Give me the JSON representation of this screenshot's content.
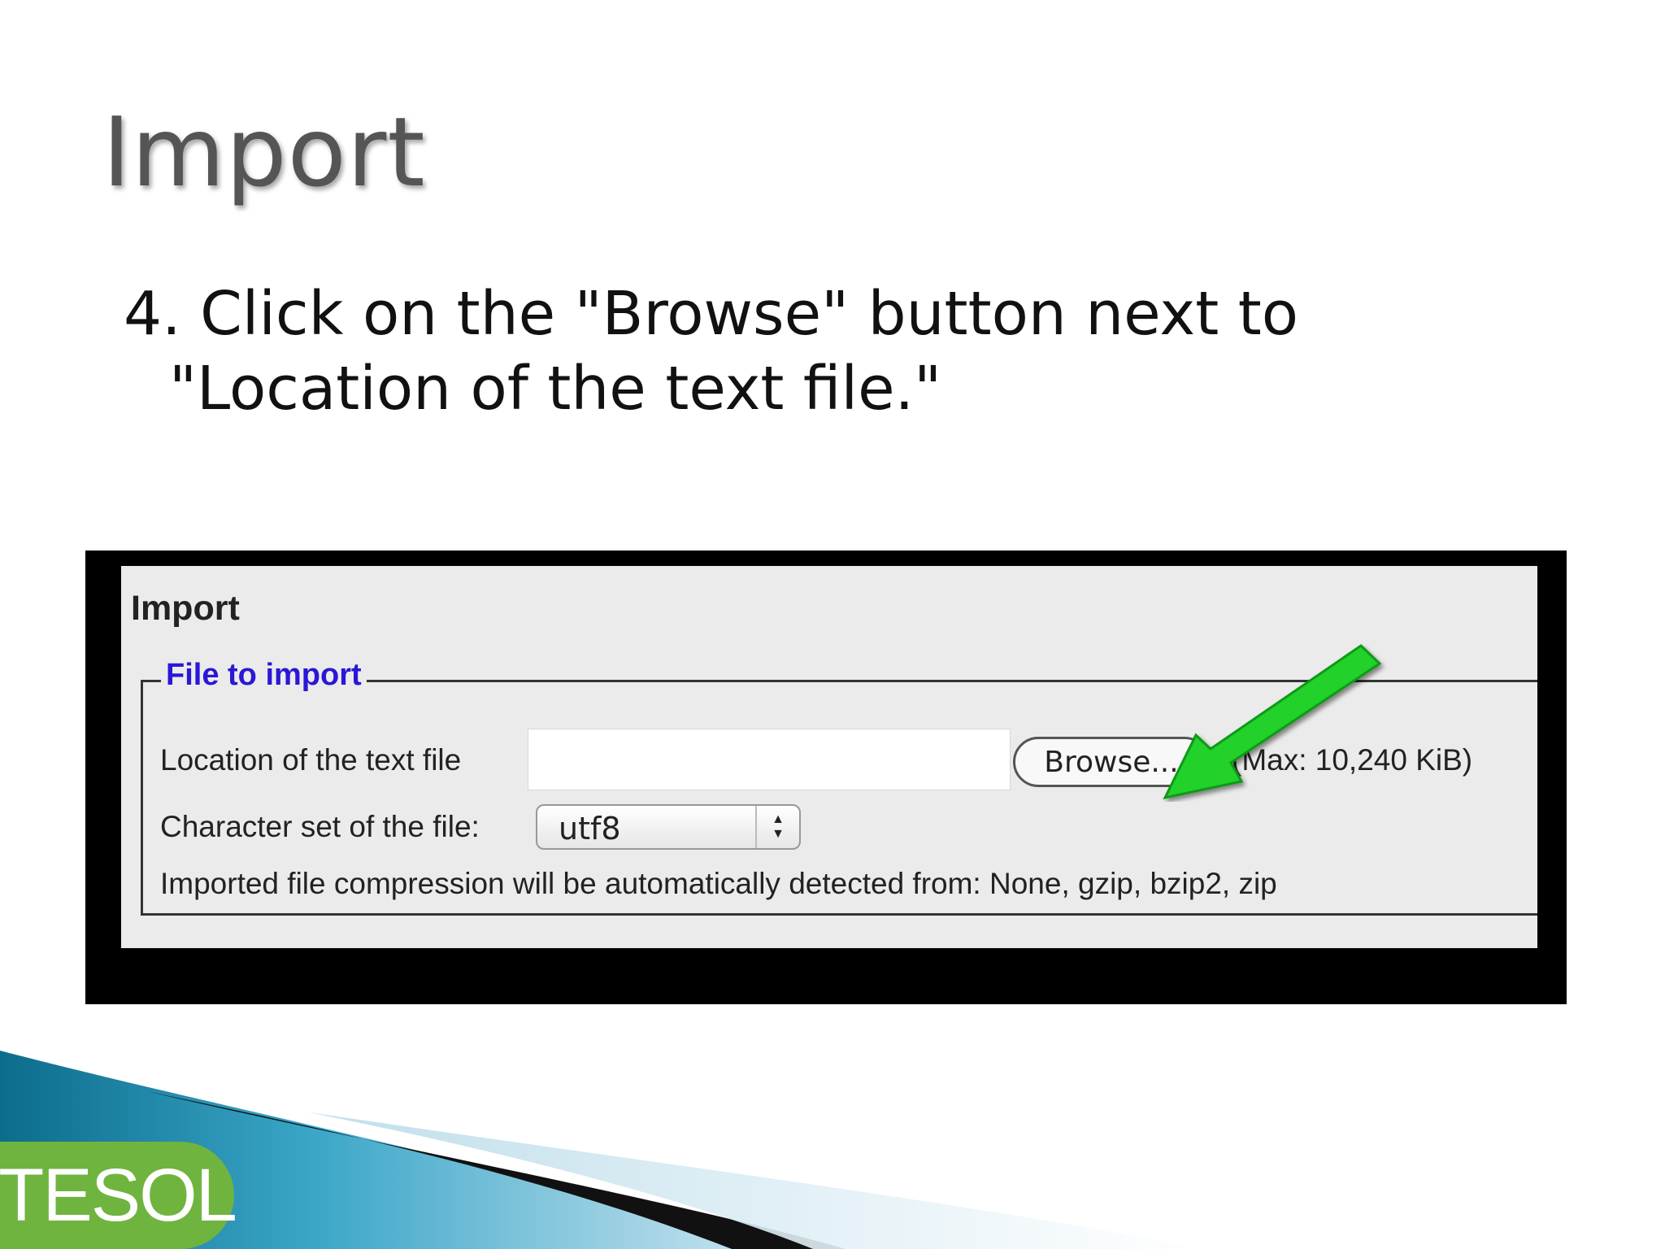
{
  "slide": {
    "title": "Import",
    "instruction_line1": "4. Click on the \"Browse\" button next to",
    "instruction_line2": "\"Location of the text file.\""
  },
  "screenshot": {
    "heading": "Import",
    "fieldset_legend": "File to import",
    "location_label": "Location of the text file",
    "location_value": "",
    "browse_label": "Browse...",
    "max_note": "(Max: 10,240 KiB)",
    "charset_label": "Character set of the file:",
    "charset_value": "utf8",
    "compression_note": "Imported file compression will be automatically detected from: None, gzip, bzip2, zip",
    "arrow_icon": "arrow-pointer-icon",
    "arrow_color": "#22d12a"
  },
  "footer": {
    "logo_text": "TESOL",
    "logo_color": "#6fb43f"
  }
}
